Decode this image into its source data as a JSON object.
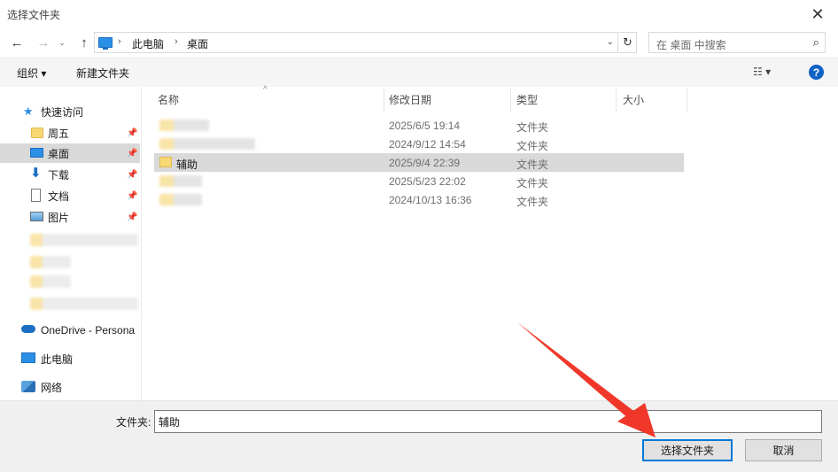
{
  "window": {
    "title": "选择文件夹",
    "close_glyph": "✕"
  },
  "address": {
    "back_glyph": "←",
    "forward_glyph": "→",
    "recent_glyph": "⌄",
    "up_glyph": "↑",
    "sep1": "›",
    "seg1": "此电脑",
    "sep2": "›",
    "seg2": "桌面",
    "dropdown_glyph": "⌄",
    "refresh_glyph": "↻"
  },
  "search": {
    "placeholder": "在 桌面 中搜索",
    "icon_glyph": "⌕"
  },
  "toolbar": {
    "organize": "组织 ▾",
    "new_folder": "新建文件夹",
    "view_glyph": "☷  ▾",
    "help_glyph": "?"
  },
  "sidebar": {
    "quick_access": "快速访问",
    "items": [
      {
        "label": "周五",
        "pin": "📌"
      },
      {
        "label": "桌面",
        "pin": "📌"
      },
      {
        "label": "下载",
        "pin": "📌"
      },
      {
        "label": "文档",
        "pin": "📌"
      },
      {
        "label": "图片",
        "pin": "📌"
      }
    ],
    "onedrive": "OneDrive - Persona",
    "this_pc": "此电脑",
    "network": "网络"
  },
  "columns": {
    "name": "名称",
    "modified": "修改日期",
    "type": "类型",
    "size": "大小",
    "sort_glyph": "^"
  },
  "files": [
    {
      "name": "",
      "modified": "2025/6/5 19:14",
      "type": "文件夹"
    },
    {
      "name": "",
      "modified": "2024/9/12 14:54",
      "type": "文件夹"
    },
    {
      "name": "辅助",
      "modified": "2025/9/4 22:39",
      "type": "文件夹"
    },
    {
      "name": "",
      "modified": "2025/5/23 22:02",
      "type": "文件夹"
    },
    {
      "name": "",
      "modified": "2024/10/13 16:36",
      "type": "文件夹"
    }
  ],
  "footer": {
    "folder_label": "文件夹:",
    "folder_value": "辅助",
    "select_button": "选择文件夹",
    "cancel_button": "取消"
  },
  "colors": {
    "selection": "#d9d9d9",
    "accent": "#0078d7",
    "annotation_arrow": "#f0382a"
  }
}
